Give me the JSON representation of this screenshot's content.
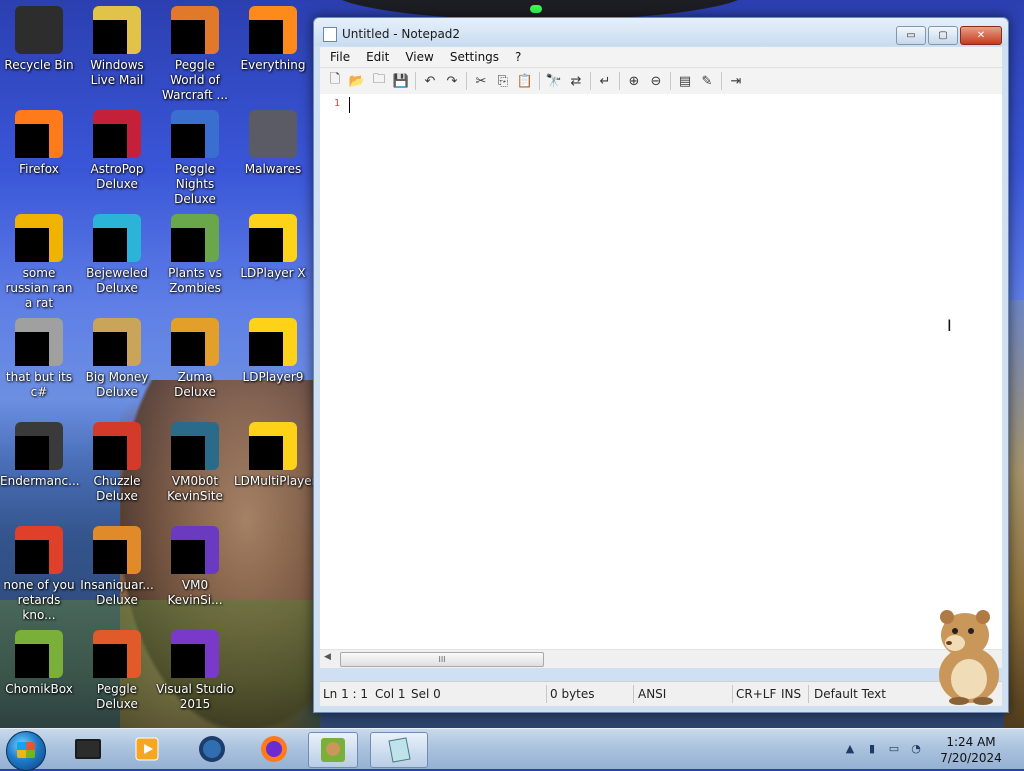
{
  "desktop": {
    "icons": [
      {
        "label": "Recycle Bin",
        "color": "#2d2d2d"
      },
      {
        "label": "Windows Live Mail",
        "color": "#e2c34a"
      },
      {
        "label": "Peggle World of Warcraft ...",
        "color": "#e07a2a"
      },
      {
        "label": "Everything",
        "color": "#ff8a1c"
      },
      {
        "label": "Firefox",
        "color": "#ff7a1a"
      },
      {
        "label": "AstroPop Deluxe",
        "color": "#c4203a"
      },
      {
        "label": "Peggle Nights Deluxe",
        "color": "#3a6fd0"
      },
      {
        "label": "Malwares",
        "color": "#5b5b66"
      },
      {
        "label": "some russian ran a rat",
        "color": "#f0b400"
      },
      {
        "label": "Bejeweled Deluxe",
        "color": "#2bb3d8"
      },
      {
        "label": "Plants vs Zombies",
        "color": "#6aa64a"
      },
      {
        "label": "LDPlayer X",
        "color": "#ffd21a"
      },
      {
        "label": "that but its c#",
        "color": "#a0a0a0"
      },
      {
        "label": "Big Money Deluxe",
        "color": "#c9a55a"
      },
      {
        "label": "Zuma Deluxe",
        "color": "#e2a02a"
      },
      {
        "label": "LDPlayer9",
        "color": "#ffd21a"
      },
      {
        "label": "Endermanc...",
        "color": "#3a3a3a"
      },
      {
        "label": "Chuzzle Deluxe",
        "color": "#d43a2a"
      },
      {
        "label": "VM0b0t KevinSite",
        "color": "#2a6b8a"
      },
      {
        "label": "LDMultiPlayer",
        "color": "#ffd21a"
      },
      {
        "label": "none of you retards kno...",
        "color": "#e0402a"
      },
      {
        "label": "Insaniquar... Deluxe",
        "color": "#e08a2a"
      },
      {
        "label": "VM0 KevinSi...",
        "color": "#6a3ac0"
      },
      {
        "label": "",
        "color": "#00000000"
      },
      {
        "label": "ChomikBox",
        "color": "#7ab03a"
      },
      {
        "label": "Peggle Deluxe",
        "color": "#e05a2a"
      },
      {
        "label": "Visual Studio 2015",
        "color": "#7a3ac9"
      },
      {
        "label": "",
        "color": "#00000000"
      }
    ]
  },
  "window": {
    "title": "Untitled - Notepad2",
    "buttons": {
      "minimize": "▭",
      "maximize": "▢",
      "close": "✕"
    },
    "menu": [
      "File",
      "Edit",
      "View",
      "Settings",
      "?"
    ],
    "toolbar_icons": [
      "new-file-icon",
      "open-folder-icon",
      "browse-icon",
      "save-icon",
      "sep",
      "undo-icon",
      "redo-icon",
      "sep",
      "cut-icon",
      "copy-icon",
      "paste-icon",
      "sep",
      "find-icon",
      "replace-icon",
      "sep",
      "word-wrap-icon",
      "sep",
      "zoom-in-icon",
      "zoom-out-icon",
      "sep",
      "scheme-icon",
      "customize-icon",
      "sep",
      "exit-icon"
    ],
    "toolbar_glyphs": {
      "new-file-icon": "🗋",
      "open-folder-icon": "📂",
      "browse-icon": "🗀",
      "save-icon": "💾",
      "undo-icon": "↶",
      "redo-icon": "↷",
      "cut-icon": "✂",
      "copy-icon": "⎘",
      "paste-icon": "📋",
      "find-icon": "🔭",
      "replace-icon": "⇄",
      "word-wrap-icon": "↵",
      "zoom-in-icon": "⊕",
      "zoom-out-icon": "⊖",
      "scheme-icon": "▤",
      "customize-icon": "✎",
      "exit-icon": "⇥"
    },
    "editor": {
      "line_number": "1"
    },
    "scrollbar": {
      "thumb_grip": "III"
    },
    "status": {
      "position": "Ln 1 : 1",
      "column": "Col 1",
      "selection": "Sel 0",
      "size": "0 bytes",
      "encoding": "ANSI",
      "line_endings": "CR+LF",
      "mode": "INS",
      "scheme": "Default Text"
    }
  },
  "taskbar": {
    "clock_time": "1:24 AM",
    "clock_date": "7/20/2024",
    "tray_chevron": "▲"
  }
}
